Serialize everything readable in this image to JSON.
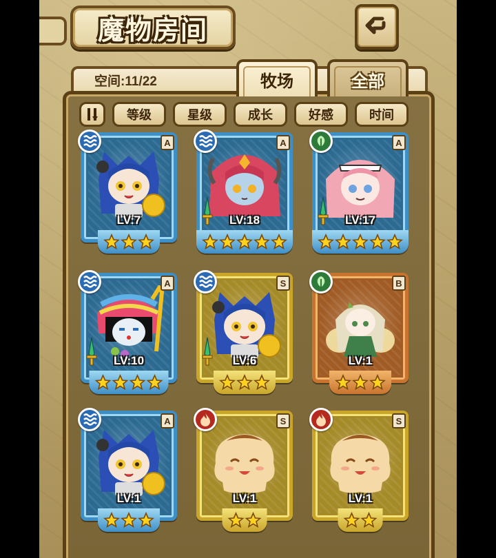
{
  "header": {
    "title": "魔物房间",
    "space_label": "空间:11/22"
  },
  "tabs": [
    {
      "label": "牧场",
      "active": true
    },
    {
      "label": "全部",
      "active": false
    }
  ],
  "filters": [
    "等级",
    "星级",
    "成长",
    "好感",
    "时间"
  ],
  "colors": {
    "frame_blue": "#3f8fc7",
    "frame_gold": "#c9a52a",
    "frame_orange": "#c8742e",
    "water": "#2b6bb3",
    "leaf": "#2d7a3a",
    "fire": "#b52a1e"
  },
  "monsters": [
    {
      "element": "water-icon",
      "rank": "A",
      "level": "LV:7",
      "stars": 3,
      "frame": "blue",
      "portrait": "blue-cat-girl",
      "weapon": false
    },
    {
      "element": "water-icon",
      "rank": "A",
      "level": "LV:18",
      "stars": 5,
      "frame": "blue",
      "portrait": "red-hair-girl",
      "weapon": true
    },
    {
      "element": "leaf-icon",
      "rank": "A",
      "level": "LV:17",
      "stars": 5,
      "frame": "blue",
      "portrait": "pink-hair-girl",
      "weapon": true
    },
    {
      "element": "water-icon",
      "rank": "A",
      "level": "LV:10",
      "stars": 4,
      "frame": "blue",
      "portrait": "feather-girl",
      "weapon": true
    },
    {
      "element": "water-icon",
      "rank": "S",
      "level": "LV:6",
      "stars": 3,
      "frame": "gold",
      "portrait": "blue-cat-girl",
      "weapon": true
    },
    {
      "element": "leaf-icon",
      "rank": "B",
      "level": "LV:1",
      "stars": 3,
      "frame": "orange",
      "portrait": "fairy-girl",
      "weapon": false
    },
    {
      "element": "water-icon",
      "rank": "A",
      "level": "LV:1",
      "stars": 3,
      "frame": "blue",
      "portrait": "blue-cat-girl",
      "weapon": false
    },
    {
      "element": "fire-icon",
      "rank": "S",
      "level": "LV:1",
      "stars": 2,
      "frame": "gold",
      "portrait": "pudding-blob",
      "weapon": false
    },
    {
      "element": "fire-icon",
      "rank": "S",
      "level": "LV:1",
      "stars": 2,
      "frame": "gold",
      "portrait": "pudding-blob",
      "weapon": false
    }
  ]
}
